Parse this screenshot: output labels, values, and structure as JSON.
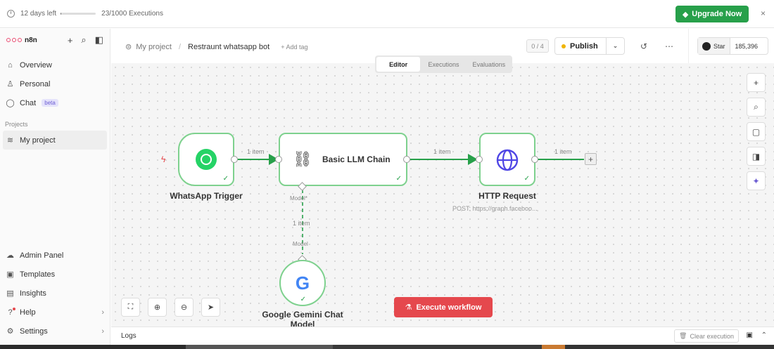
{
  "banner": {
    "trial": "12 days left",
    "trial_progress": 0.02,
    "executions": "23/1000 Executions",
    "upgrade": "Upgrade Now",
    "close": "×"
  },
  "sidebar": {
    "logo": "n8n",
    "items": [
      {
        "label": "Overview",
        "icon": "home-icon"
      },
      {
        "label": "Personal",
        "icon": "user-icon"
      },
      {
        "label": "Chat",
        "icon": "chat-icon",
        "badge": "beta"
      }
    ],
    "projects_label": "Projects",
    "project": "My project",
    "bottom": [
      {
        "label": "Admin Panel",
        "icon": "cloud-icon"
      },
      {
        "label": "Templates",
        "icon": "templates-icon"
      },
      {
        "label": "Insights",
        "icon": "chart-icon"
      },
      {
        "label": "Help",
        "icon": "help-icon"
      },
      {
        "label": "Settings",
        "icon": "gear-icon"
      }
    ]
  },
  "header": {
    "project": "My project",
    "workflow": "Restraunt whatsapp bot",
    "add_tag": "+ Add tag",
    "counter": "0 / 4",
    "publish": "Publish",
    "star": "Star",
    "stars": "185,396"
  },
  "tabs": [
    "Editor",
    "Executions",
    "Evaluations"
  ],
  "nodes": {
    "trigger": "WhatsApp Trigger",
    "chain": "Basic LLM Chain",
    "http": "HTTP Request",
    "http_sub": "POST: https://graph.faceboo...",
    "gemini": "Google Gemini Chat Model",
    "model_out": "Model*",
    "model_in": "Model"
  },
  "edges": {
    "e1": "1 item",
    "e2": "1 item",
    "e3": "1 item",
    "e4": "1 item"
  },
  "execute": "Execute workflow",
  "logs": {
    "label": "Logs",
    "clear": "Clear execution"
  }
}
